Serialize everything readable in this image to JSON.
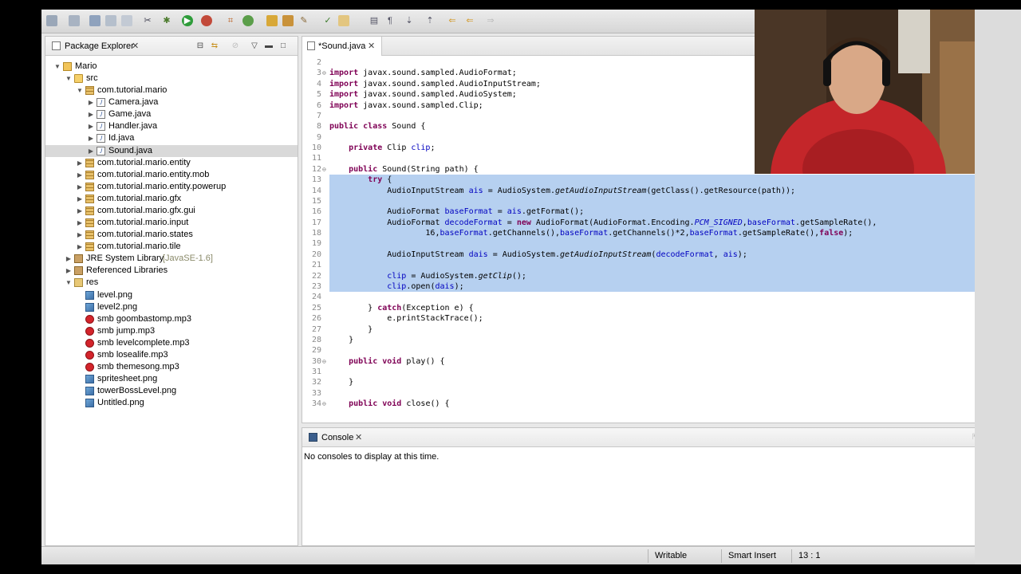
{
  "colors": {
    "keyword": "#7f0055",
    "field": "#0000c0",
    "selection": "#b6d0f0",
    "lineno": "#8a8a8a"
  },
  "package_explorer": {
    "title": "Package Explorer",
    "tree": [
      {
        "label": "Mario",
        "icon": "project-icon",
        "depth": 0,
        "twisty": "open"
      },
      {
        "label": "src",
        "icon": "source-folder-icon",
        "depth": 1,
        "twisty": "open"
      },
      {
        "label": "com.tutorial.mario",
        "icon": "package-icon",
        "depth": 2,
        "twisty": "open"
      },
      {
        "label": "Camera.java",
        "icon": "java-file-icon",
        "depth": 3,
        "twisty": "closed"
      },
      {
        "label": "Game.java",
        "icon": "java-file-icon",
        "depth": 3,
        "twisty": "closed"
      },
      {
        "label": "Handler.java",
        "icon": "java-file-icon",
        "depth": 3,
        "twisty": "closed"
      },
      {
        "label": "Id.java",
        "icon": "java-file-icon",
        "depth": 3,
        "twisty": "closed"
      },
      {
        "label": "Sound.java",
        "icon": "java-file-icon",
        "depth": 3,
        "twisty": "closed",
        "selected": true
      },
      {
        "label": "com.tutorial.mario.entity",
        "icon": "package-icon",
        "depth": 2,
        "twisty": "closed"
      },
      {
        "label": "com.tutorial.mario.entity.mob",
        "icon": "package-icon",
        "depth": 2,
        "twisty": "closed"
      },
      {
        "label": "com.tutorial.mario.entity.powerup",
        "icon": "package-icon",
        "depth": 2,
        "twisty": "closed"
      },
      {
        "label": "com.tutorial.mario.gfx",
        "icon": "package-icon",
        "depth": 2,
        "twisty": "closed"
      },
      {
        "label": "com.tutorial.mario.gfx.gui",
        "icon": "package-icon",
        "depth": 2,
        "twisty": "closed"
      },
      {
        "label": "com.tutorial.mario.input",
        "icon": "package-icon",
        "depth": 2,
        "twisty": "closed"
      },
      {
        "label": "com.tutorial.mario.states",
        "icon": "package-icon",
        "depth": 2,
        "twisty": "closed"
      },
      {
        "label": "com.tutorial.mario.tile",
        "icon": "package-icon",
        "depth": 2,
        "twisty": "closed"
      },
      {
        "label": "JRE System Library",
        "decoration": "[JavaSE-1.6]",
        "icon": "library-icon",
        "depth": 1,
        "twisty": "closed"
      },
      {
        "label": "Referenced Libraries",
        "icon": "library-icon",
        "depth": 1,
        "twisty": "closed"
      },
      {
        "label": "res",
        "icon": "folder-icon",
        "depth": 1,
        "twisty": "open"
      },
      {
        "label": "level.png",
        "icon": "image-file-icon",
        "depth": 2,
        "twisty": "none"
      },
      {
        "label": "level2.png",
        "icon": "image-file-icon",
        "depth": 2,
        "twisty": "none"
      },
      {
        "label": "smb goombastomp.mp3",
        "icon": "audio-file-icon",
        "depth": 2,
        "twisty": "none"
      },
      {
        "label": "smb jump.mp3",
        "icon": "audio-file-icon",
        "depth": 2,
        "twisty": "none"
      },
      {
        "label": "smb levelcomplete.mp3",
        "icon": "audio-file-icon",
        "depth": 2,
        "twisty": "none"
      },
      {
        "label": "smb losealife.mp3",
        "icon": "audio-file-icon",
        "depth": 2,
        "twisty": "none"
      },
      {
        "label": "smb themesong.mp3",
        "icon": "audio-file-icon",
        "depth": 2,
        "twisty": "none"
      },
      {
        "label": "spritesheet.png",
        "icon": "image-file-icon",
        "depth": 2,
        "twisty": "none"
      },
      {
        "label": "towerBossLevel.png",
        "icon": "image-file-icon",
        "depth": 2,
        "twisty": "none"
      },
      {
        "label": "Untitled.png",
        "icon": "image-file-icon",
        "depth": 2,
        "twisty": "none"
      }
    ]
  },
  "editor": {
    "tab_label": "*Sound.java",
    "lines": [
      {
        "n": "2",
        "text": "",
        "fold": ""
      },
      {
        "n": "3",
        "text": "import javax.sound.sampled.AudioFormat;",
        "fold": "⊖"
      },
      {
        "n": "4",
        "text": "import javax.sound.sampled.AudioInputStream;",
        "fold": ""
      },
      {
        "n": "5",
        "text": "import javax.sound.sampled.AudioSystem;",
        "fold": ""
      },
      {
        "n": "6",
        "text": "import javax.sound.sampled.Clip;",
        "fold": ""
      },
      {
        "n": "7",
        "text": "",
        "fold": ""
      },
      {
        "n": "8",
        "text": "public class Sound {",
        "fold": ""
      },
      {
        "n": "9",
        "text": "",
        "fold": ""
      },
      {
        "n": "10",
        "text": "    private Clip clip;",
        "fold": ""
      },
      {
        "n": "11",
        "text": "",
        "fold": ""
      },
      {
        "n": "12",
        "text": "    public Sound(String path) {",
        "fold": "⊖"
      },
      {
        "n": "13",
        "text": "        try {",
        "fold": "",
        "hl": true
      },
      {
        "n": "14",
        "text": "            AudioInputStream ais = AudioSystem.getAudioInputStream(getClass().getResource(path));",
        "fold": "",
        "hl": true
      },
      {
        "n": "15",
        "text": "",
        "fold": "",
        "hl": true
      },
      {
        "n": "16",
        "text": "            AudioFormat baseFormat = ais.getFormat();",
        "fold": "",
        "hl": true
      },
      {
        "n": "17",
        "text": "            AudioFormat decodeFormat = new AudioFormat(AudioFormat.Encoding.PCM_SIGNED,baseFormat.getSampleRate(),",
        "fold": "",
        "hl": true
      },
      {
        "n": "18",
        "text": "                    16,baseFormat.getChannels(),baseFormat.getChannels()*2,baseFormat.getSampleRate(),false);",
        "fold": "",
        "hl": true
      },
      {
        "n": "19",
        "text": "",
        "fold": "",
        "hl": true
      },
      {
        "n": "20",
        "text": "            AudioInputStream dais = AudioSystem.getAudioInputStream(decodeFormat, ais);",
        "fold": "",
        "hl": true
      },
      {
        "n": "21",
        "text": "",
        "fold": "",
        "hl": true
      },
      {
        "n": "22",
        "text": "            clip = AudioSystem.getClip();",
        "fold": "",
        "hl": true
      },
      {
        "n": "23",
        "text": "            clip.open(dais);",
        "fold": "",
        "hl": true
      },
      {
        "n": "24",
        "text": "",
        "fold": ""
      },
      {
        "n": "25",
        "text": "        } catch(Exception e) {",
        "fold": ""
      },
      {
        "n": "26",
        "text": "            e.printStackTrace();",
        "fold": ""
      },
      {
        "n": "27",
        "text": "        }",
        "fold": ""
      },
      {
        "n": "28",
        "text": "    }",
        "fold": ""
      },
      {
        "n": "29",
        "text": "",
        "fold": ""
      },
      {
        "n": "30",
        "text": "    public void play() {",
        "fold": "⊖"
      },
      {
        "n": "31",
        "text": "",
        "fold": ""
      },
      {
        "n": "32",
        "text": "    }",
        "fold": ""
      },
      {
        "n": "33",
        "text": "",
        "fold": ""
      },
      {
        "n": "34",
        "text": "    public void close() {",
        "fold": "⊖"
      }
    ]
  },
  "console": {
    "title": "Console",
    "message": "No consoles to display at this time."
  },
  "status_bar": {
    "writable": "Writable",
    "insert_mode": "Smart Insert",
    "cursor_position": "13 : 1"
  }
}
